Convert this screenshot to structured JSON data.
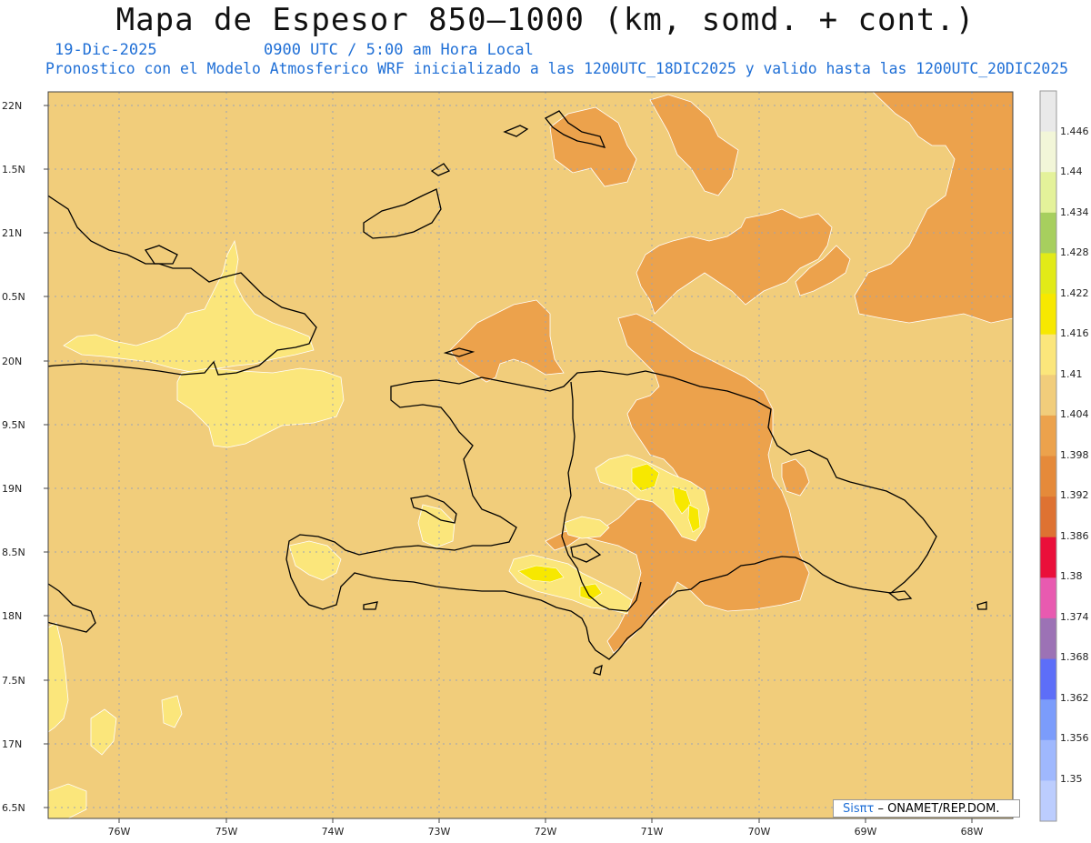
{
  "header": {
    "title": "Mapa de Espesor 850–1000 (km, somd. + cont.)",
    "date": "19-Dic-2025",
    "time": "0900 UTC / 5:00 am Hora Local",
    "description": "Pronostico con el Modelo Atmosferico WRF inicializado a las 1200UTC_18DIC2025 y valido hasta las  1200UTC_20DIC2025"
  },
  "axes": {
    "lat_labels": [
      "22N",
      "1.5N",
      "21N",
      "0.5N",
      "20N",
      "9.5N",
      "19N",
      "8.5N",
      "18N",
      "7.5N",
      "17N",
      "6.5N"
    ],
    "lon_labels": [
      "76W",
      "75W",
      "74W",
      "73W",
      "72W",
      "71W",
      "70W",
      "69W",
      "68W"
    ]
  },
  "colorbar": {
    "levels": [
      "1.446",
      "1.44",
      "1.434",
      "1.428",
      "1.422",
      "1.416",
      "1.41",
      "1.404",
      "1.398",
      "1.392",
      "1.386",
      "1.38",
      "1.374",
      "1.368",
      "1.362",
      "1.356",
      "1.35"
    ],
    "colors": [
      "#e9e9e9",
      "#f2f6d8",
      "#e4f29a",
      "#a7cf5e",
      "#e2ea17",
      "#f7e800",
      "#fbe67b",
      "#f1cd7b",
      "#eca24c",
      "#e58a3a",
      "#de7232",
      "#ea0f3a",
      "#e85ab0",
      "#9c72b5",
      "#5d6ef8",
      "#7b9cfb",
      "#9fb8fd",
      "#bccdfe"
    ]
  },
  "credit": {
    "brand": "Sisπτ",
    "org": "–  ONAMET/REP.DOM."
  }
}
